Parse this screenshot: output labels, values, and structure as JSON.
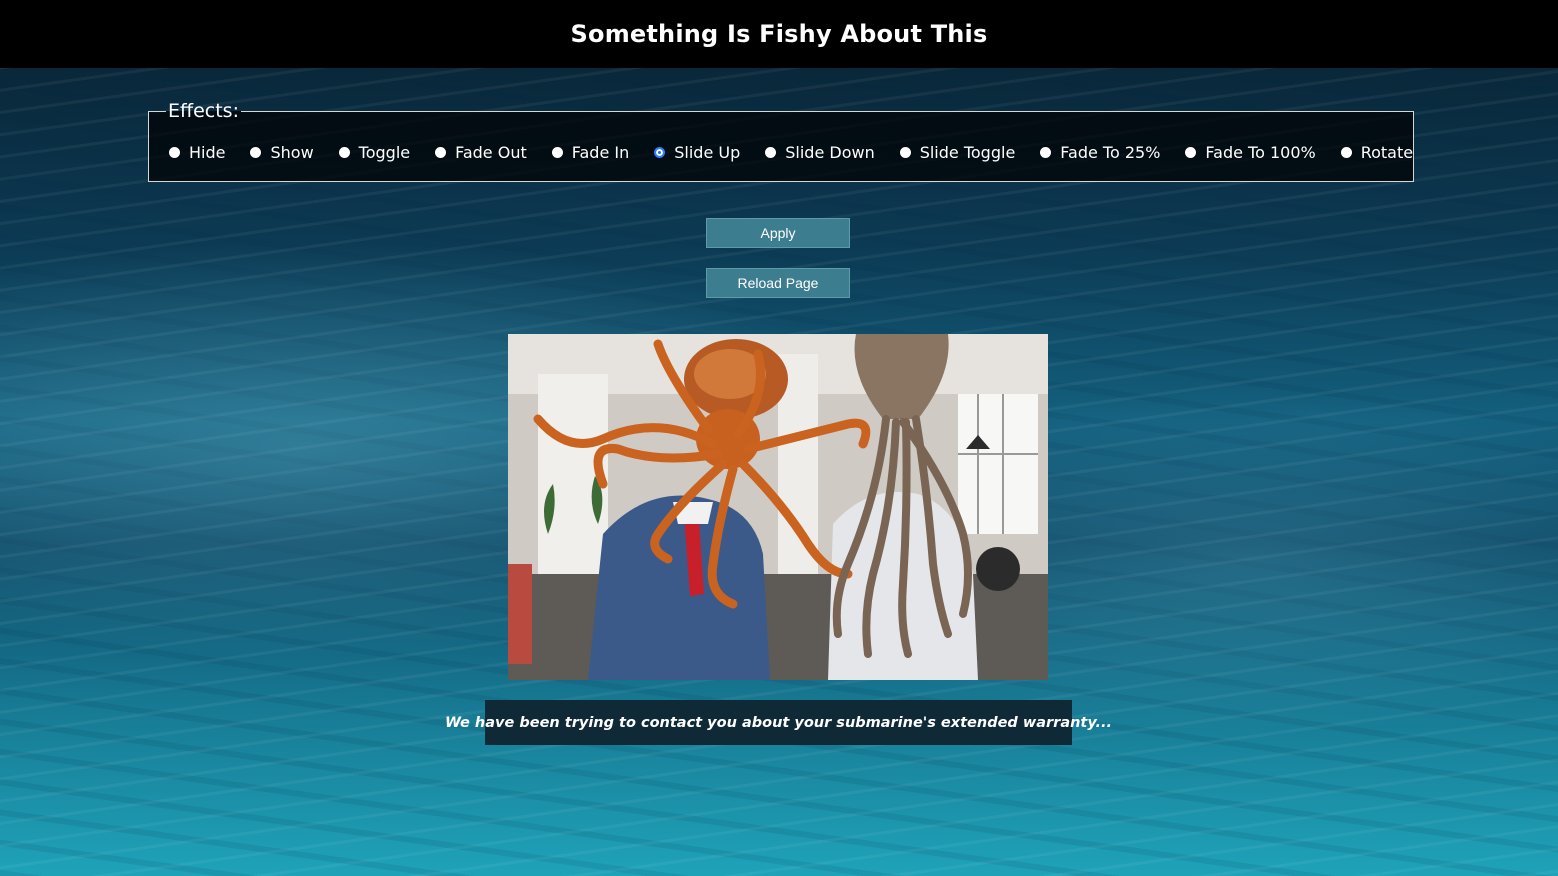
{
  "header": {
    "title": "Something Is Fishy About This"
  },
  "effects": {
    "legend": "Effects:",
    "selected": "Slide Up",
    "options": [
      {
        "label": "Hide"
      },
      {
        "label": "Show"
      },
      {
        "label": "Toggle"
      },
      {
        "label": "Fade Out"
      },
      {
        "label": "Fade In"
      },
      {
        "label": "Slide Up"
      },
      {
        "label": "Slide Down"
      },
      {
        "label": "Slide Toggle"
      },
      {
        "label": "Fade To 25%"
      },
      {
        "label": "Fade To 100%"
      },
      {
        "label": "Rotate"
      }
    ]
  },
  "buttons": {
    "apply": "Apply",
    "reload": "Reload Page"
  },
  "caption": "We have been trying to contact you about your submarine's extended warranty...",
  "colors": {
    "header_bg": "#000000",
    "button_bg": "#3c7d8f",
    "caption_bg": "#0f2a36",
    "radio_selected": "#1a73e8"
  }
}
